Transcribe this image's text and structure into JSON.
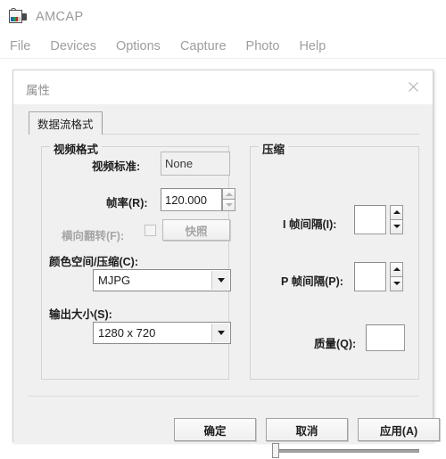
{
  "app": {
    "title": "AMCAP",
    "icon": "camcorder-icon",
    "icon_colors": [
      "#1f5fd0",
      "#18a13c",
      "#d01f1f",
      "#c8c8c8"
    ],
    "menu": [
      "File",
      "Devices",
      "Options",
      "Capture",
      "Photo",
      "Help"
    ]
  },
  "dialog": {
    "title": "属性",
    "close_icon": "close-icon",
    "tabs": [
      {
        "label": "数据流格式",
        "selected": true
      }
    ],
    "video_group": {
      "legend": "视频格式",
      "video_standard": {
        "label": "视频标准:",
        "value": "None",
        "readonly": true
      },
      "frame_rate": {
        "label": "帧率(R):",
        "value": "120.000",
        "spinner": true
      },
      "flip_horizontal": {
        "label": "横向翻转(F):",
        "checked": false,
        "disabled": true
      },
      "snapshot_button": {
        "label": "快照",
        "disabled": true
      },
      "color_space": {
        "label": "颜色空间/压缩(C):",
        "value": "MJPG",
        "options": [
          "MJPG"
        ]
      },
      "output_size": {
        "label": "输出大小(S):",
        "value": "1280 x 720",
        "options": [
          "1280 x 720"
        ]
      }
    },
    "compression_group": {
      "legend": "压缩",
      "i_frame_interval": {
        "label": "I 帧间隔(I):",
        "value": "",
        "spinner": true
      },
      "p_frame_interval": {
        "label": "P 帧间隔(P):",
        "value": "",
        "spinner": true
      },
      "quality": {
        "label": "质量(Q):",
        "value": "",
        "slider_position_percent": 0
      }
    },
    "buttons": {
      "ok": "确定",
      "cancel": "取消",
      "apply": "应用(A)"
    }
  },
  "colors": {
    "dialog_face": "#f0f0f0",
    "window_face": "#ffffff",
    "border": "#d3d3d3",
    "text": "#1d1d1d",
    "disabled_text": "#a6a6a6",
    "title_text": "#8f8f8f"
  }
}
